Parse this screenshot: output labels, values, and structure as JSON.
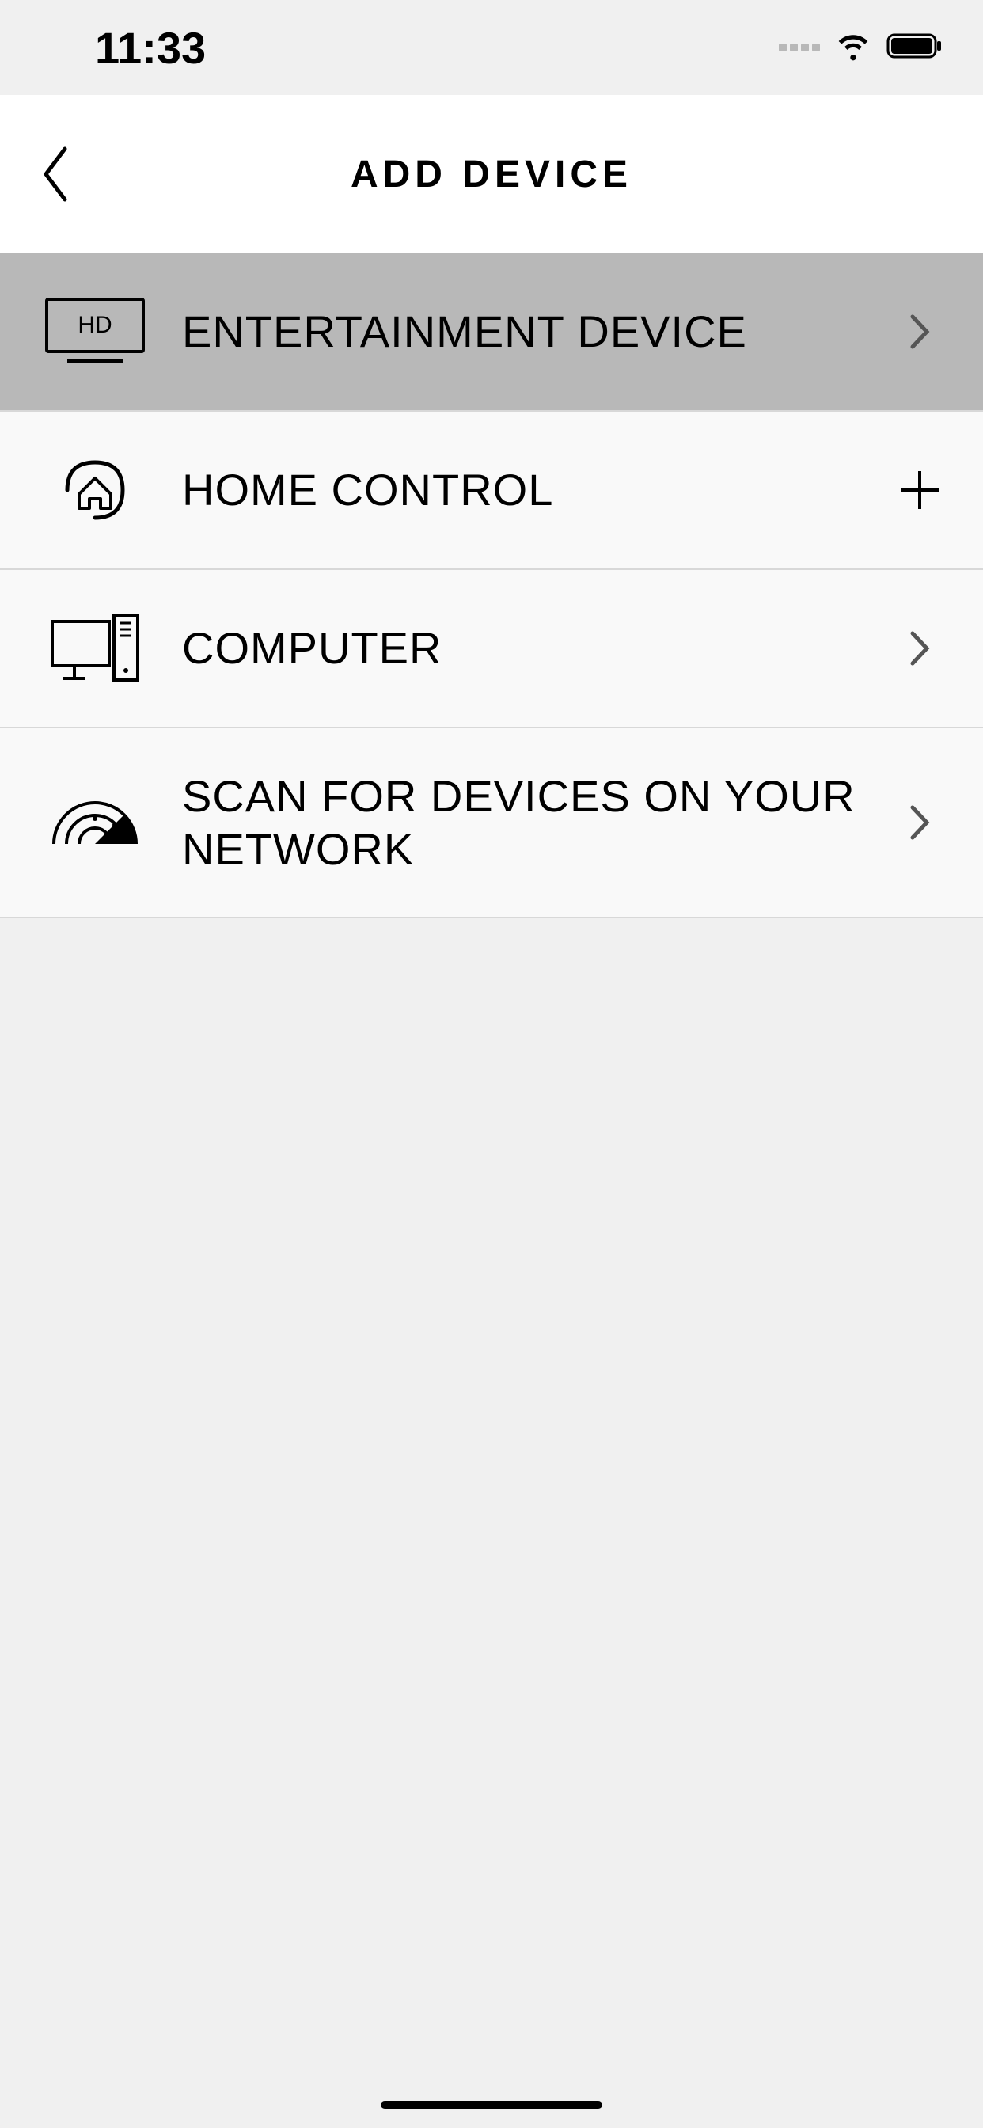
{
  "status": {
    "time": "11:33"
  },
  "header": {
    "title": "ADD DEVICE"
  },
  "list": {
    "items": [
      {
        "label": "ENTERTAINMENT DEVICE",
        "icon": "tv-hd-icon",
        "action": "chevron",
        "selected": true
      },
      {
        "label": "HOME CONTROL",
        "icon": "home-icon",
        "action": "plus",
        "selected": false
      },
      {
        "label": "COMPUTER",
        "icon": "computer-icon",
        "action": "chevron",
        "selected": false
      },
      {
        "label": "SCAN FOR DEVICES ON YOUR NETWORK",
        "icon": "radar-icon",
        "action": "chevron",
        "selected": false
      }
    ]
  }
}
